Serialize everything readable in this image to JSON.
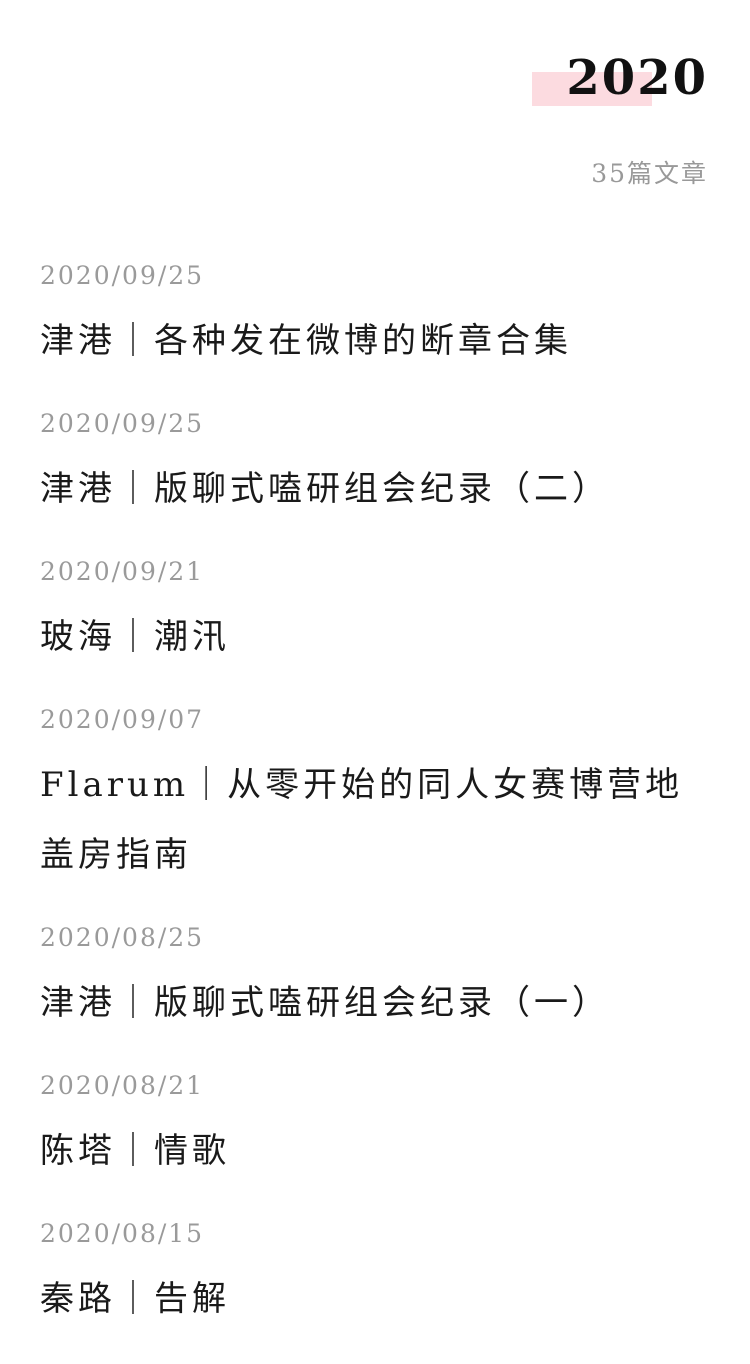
{
  "archive": {
    "year": "2020",
    "count_label": "35篇文章",
    "accent_color": "#fcdbe0"
  },
  "posts": [
    {
      "date": "2020/09/25",
      "title": "津港｜各种发在微博的断章合集"
    },
    {
      "date": "2020/09/25",
      "title": "津港｜版聊式嗑研组会纪录（二）"
    },
    {
      "date": "2020/09/21",
      "title": "玻海｜潮汛"
    },
    {
      "date": "2020/09/07",
      "title": "Flarum｜从零开始的同人女赛博营地盖房指南"
    },
    {
      "date": "2020/08/25",
      "title": "津港｜版聊式嗑研组会纪录（一）"
    },
    {
      "date": "2020/08/21",
      "title": "陈塔｜情歌"
    },
    {
      "date": "2020/08/15",
      "title": "秦路｜告解"
    }
  ]
}
